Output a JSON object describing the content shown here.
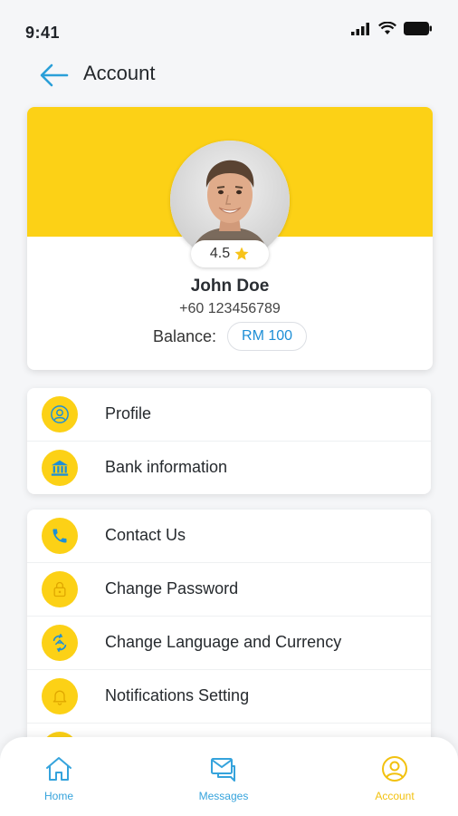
{
  "status_bar": {
    "time": "9:41"
  },
  "header": {
    "title": "Account"
  },
  "profile": {
    "rating": "4.5",
    "name": "John Doe",
    "phone": "+60 123456789",
    "balance_label": "Balance:",
    "balance_value": "RM 100"
  },
  "menu_group_1": [
    {
      "label": "Profile",
      "icon": "user-circle-icon"
    },
    {
      "label": "Bank information",
      "icon": "bank-icon"
    }
  ],
  "menu_group_2": [
    {
      "label": "Contact Us",
      "icon": "phone-icon"
    },
    {
      "label": "Change Password",
      "icon": "lock-icon"
    },
    {
      "label": "Change Language and Currency",
      "icon": "exchange-icon"
    },
    {
      "label": "Notifications Setting",
      "icon": "bell-icon"
    }
  ],
  "bottom_nav": [
    {
      "label": "Home",
      "icon": "home-icon",
      "active": false
    },
    {
      "label": "Messages",
      "icon": "messages-icon",
      "active": false
    },
    {
      "label": "Account",
      "icon": "account-icon",
      "active": true
    }
  ],
  "colors": {
    "brand_yellow": "#fcd116",
    "accent_blue": "#1e8fd6",
    "active_nav": "#f2c10f",
    "inactive_nav": "#35a3dc"
  }
}
